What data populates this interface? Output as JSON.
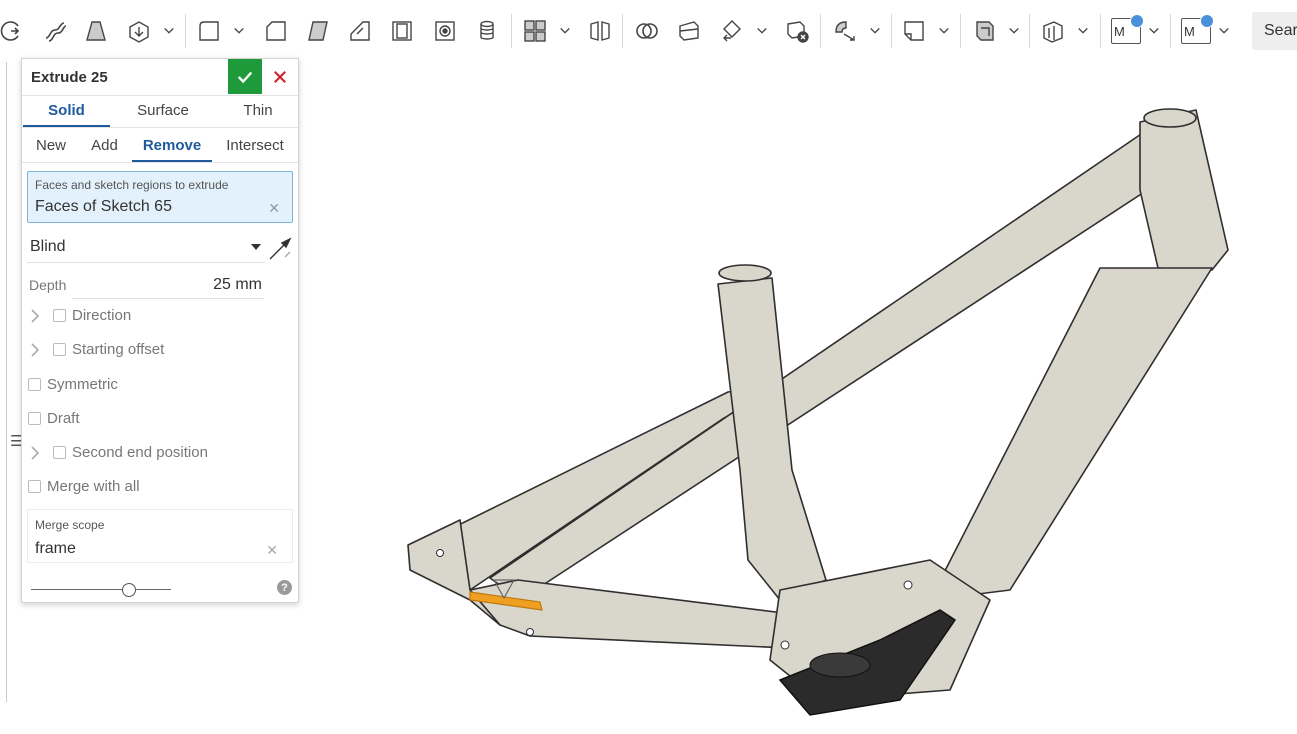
{
  "toolbar": {
    "search_label": "Sear",
    "mi_label_1": "M",
    "mi_label_2": "M"
  },
  "dialog": {
    "title": "Extrude 25",
    "body_tabs": [
      {
        "label": "Solid",
        "active": true
      },
      {
        "label": "Surface",
        "active": false
      },
      {
        "label": "Thin",
        "active": false
      }
    ],
    "op_tabs": [
      {
        "label": "New",
        "active": false
      },
      {
        "label": "Add",
        "active": false
      },
      {
        "label": "Remove",
        "active": true
      },
      {
        "label": "Intersect",
        "active": false
      }
    ],
    "faces_label": "Faces and sketch regions to extrude",
    "faces_value": "Faces of Sketch 65",
    "end_type": "Blind",
    "depth_label": "Depth",
    "depth_value": "25 mm",
    "options": {
      "direction": "Direction",
      "starting_offset": "Starting offset",
      "symmetric": "Symmetric",
      "draft": "Draft",
      "second_end": "Second end position",
      "merge_all": "Merge with all"
    },
    "merge_scope_label": "Merge scope",
    "merge_scope_value": "frame",
    "help": "?"
  },
  "viewport": {
    "frame_color": "#d9d6cc",
    "outline_color": "#2f2f2f",
    "motor_color": "#2b2b2b",
    "highlight_color": "#f0a020"
  }
}
